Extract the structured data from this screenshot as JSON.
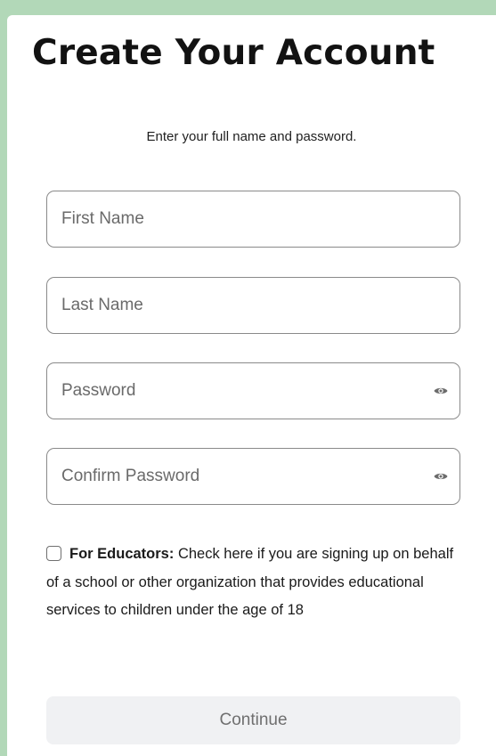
{
  "page": {
    "title": "Create Your Account",
    "subtitle": "Enter your full name and password."
  },
  "form": {
    "first_name": {
      "placeholder": "First Name",
      "value": ""
    },
    "last_name": {
      "placeholder": "Last Name",
      "value": ""
    },
    "password": {
      "placeholder": "Password",
      "value": "",
      "icon": "eye-icon"
    },
    "confirm_password": {
      "placeholder": "Confirm Password",
      "value": "",
      "icon": "eye-icon"
    }
  },
  "educator": {
    "checked": false,
    "label_bold": "For Educators:",
    "label_text": "Check here if you are signing up on behalf of a school or other organization that provides educational services to children under the age of 18"
  },
  "actions": {
    "continue_label": "Continue"
  },
  "colors": {
    "background": "#b2d8b8",
    "card": "#ffffff",
    "button_bg": "#f0f1f3",
    "button_text": "#6f6f6f",
    "border": "#8a8a8a"
  }
}
